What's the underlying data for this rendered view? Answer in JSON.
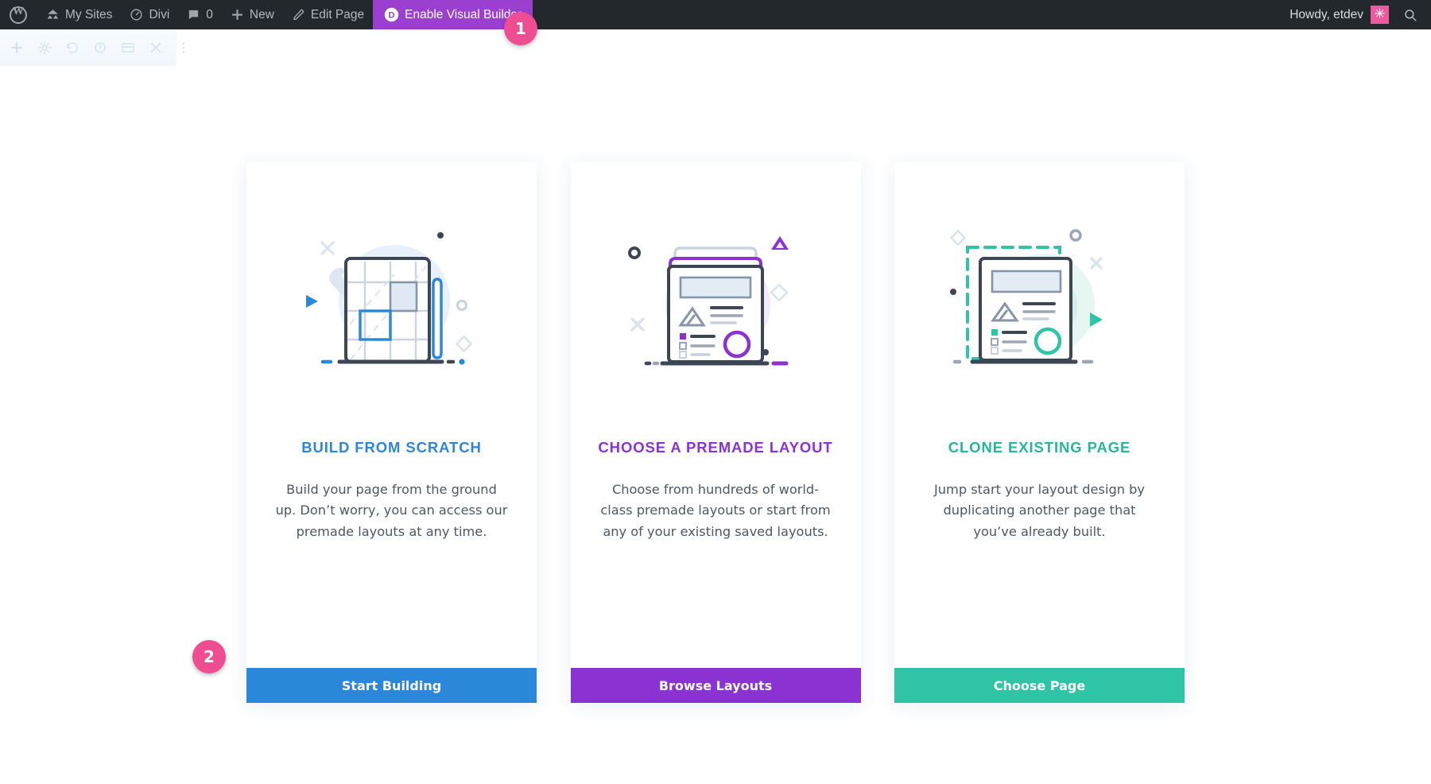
{
  "admin_bar": {
    "items": [
      {
        "id": "wp-logo",
        "label": "",
        "icon": "wordpress-icon"
      },
      {
        "id": "my-sites",
        "label": "My Sites",
        "icon": "sites-icon"
      },
      {
        "id": "divi",
        "label": "Divi",
        "icon": "divi-dashboard-icon"
      },
      {
        "id": "comments",
        "label": "0",
        "icon": "comment-bubble-icon"
      },
      {
        "id": "new",
        "label": "New",
        "icon": "plus-icon"
      },
      {
        "id": "edit-page",
        "label": "Edit Page",
        "icon": "pencil-icon"
      }
    ],
    "visual_builder": {
      "label": "Enable Visual Builder",
      "icon_letter": "D",
      "bg": "#9b3fd0"
    },
    "howdy": "Howdy, etdev",
    "avatar_glyph": "✳",
    "avatar_bg": "#ef5a9e",
    "search_icon": "search-icon"
  },
  "divi_toolbar": {
    "icons": [
      "add-icon",
      "settings-gear-icon",
      "history-icon",
      "portability-icon",
      "wireframe-icon",
      "close-icon",
      "more-options-icon"
    ]
  },
  "badges": [
    {
      "id": "badge-1",
      "number": "1"
    },
    {
      "id": "badge-2",
      "number": "2"
    }
  ],
  "cards": [
    {
      "id": "build-from-scratch",
      "title": "BUILD FROM SCRATCH",
      "title_color": "#2b87da",
      "body": "Build your page from the ground up. Don’t worry, you can access our premade layouts at any time.",
      "button_label": "Start Building",
      "button_color": "#2b87da",
      "illustration": "blueprint-grid-pencil-illustration"
    },
    {
      "id": "choose-premade-layout",
      "title": "CHOOSE A PREMADE LAYOUT",
      "title_color": "#8b32d3",
      "body": "Choose from hundreds of world-class premade layouts or start from any of your existing saved layouts.",
      "button_label": "Browse Layouts",
      "button_color": "#8b32d3",
      "illustration": "stacked-layout-pages-illustration"
    },
    {
      "id": "clone-existing-page",
      "title": "CLONE EXISTING PAGE",
      "title_color": "#27b69a",
      "body": "Jump start your layout design by duplicating another page that you’ve already built.",
      "button_label": "Choose Page",
      "button_color": "#2ec4a5",
      "illustration": "duplicate-page-selection-illustration"
    }
  ]
}
